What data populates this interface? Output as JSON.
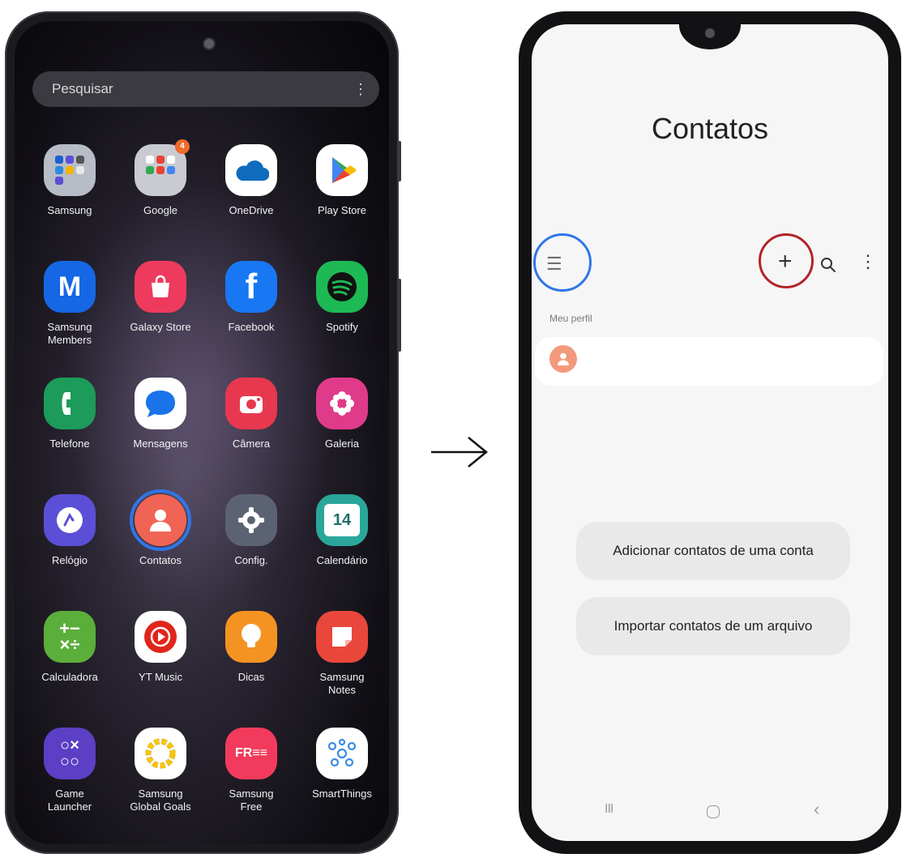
{
  "launcher": {
    "search_label": "Pesquisar",
    "more_glyph": "⋮",
    "apps": [
      {
        "label": "Samsung",
        "icon": "samsung-folder-icon",
        "color": "#b7bcc6"
      },
      {
        "label": "Google",
        "icon": "google-folder-icon",
        "color": "#c9cbd1",
        "badge": "4"
      },
      {
        "label": "OneDrive",
        "icon": "onedrive-icon",
        "color": "#ffffff"
      },
      {
        "label": "Play Store",
        "icon": "play-store-icon",
        "color": "#ffffff"
      },
      {
        "label": "Samsung\nMembers",
        "icon": "samsung-members-icon",
        "color": "#1667e5"
      },
      {
        "label": "Galaxy Store",
        "icon": "galaxy-store-icon",
        "color": "#ee3b5d"
      },
      {
        "label": "Facebook",
        "icon": "facebook-icon",
        "color": "#1877f2"
      },
      {
        "label": "Spotify",
        "icon": "spotify-icon",
        "color": "#1db954"
      },
      {
        "label": "Telefone",
        "icon": "phone-icon",
        "color": "#1c9b5a"
      },
      {
        "label": "Mensagens",
        "icon": "messages-icon",
        "color": "#ffffff"
      },
      {
        "label": "Câmera",
        "icon": "camera-icon",
        "color": "#e8384f"
      },
      {
        "label": "Galeria",
        "icon": "gallery-icon",
        "color": "#e03a8a"
      },
      {
        "label": "Relógio",
        "icon": "clock-icon",
        "color": "#5a4fd6"
      },
      {
        "label": "Contatos",
        "icon": "contacts-icon",
        "color": "#f06455"
      },
      {
        "label": "Config.",
        "icon": "settings-icon",
        "color": "#5b6273"
      },
      {
        "label": "Calendário",
        "icon": "calendar-icon",
        "color": "#2aa79a",
        "day": "14"
      },
      {
        "label": "Calculadora",
        "icon": "calculator-icon",
        "color": "#5cae3b"
      },
      {
        "label": "YT Music",
        "icon": "yt-music-icon",
        "color": "#ffffff"
      },
      {
        "label": "Dicas",
        "icon": "tips-icon",
        "color": "#f49322"
      },
      {
        "label": "Samsung\nNotes",
        "icon": "samsung-notes-icon",
        "color": "#e9473b"
      },
      {
        "label": "Game\nLauncher",
        "icon": "game-launcher-icon",
        "color": "#5b3fc4"
      },
      {
        "label": "Samsung\nGlobal Goals",
        "icon": "global-goals-icon",
        "color": "#ffffff"
      },
      {
        "label": "Samsung\nFree",
        "icon": "samsung-free-icon",
        "color": "#f23b5c"
      },
      {
        "label": "SmartThings",
        "icon": "smartthings-icon",
        "color": "#ffffff"
      }
    ]
  },
  "arrow_glyph": "→",
  "contacts": {
    "title": "Contatos",
    "section_label": "Meu perfil",
    "add_glyph": "+",
    "menu_glyph": "☰",
    "more_glyph": "⋮",
    "buttons": {
      "add_from_account": "Adicionar contatos de uma conta",
      "import_from_file": "Importar contatos de um arquivo"
    },
    "nav": {
      "recent": "III",
      "back": "‹"
    },
    "highlight_colors": {
      "menu": "#2f76e8",
      "add": "#b3232a"
    }
  }
}
